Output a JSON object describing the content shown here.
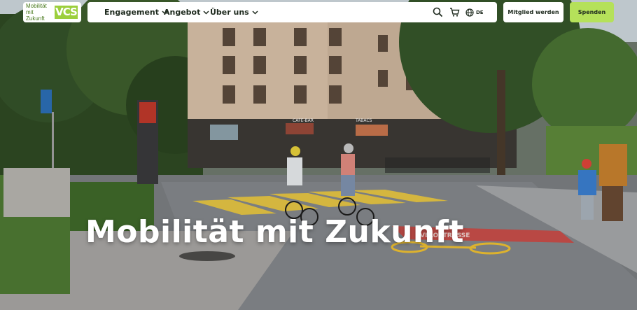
{
  "logo": {
    "text_line1": "Mobilität",
    "text_line2": "mit Zukunft",
    "mark": "VCS",
    "brand_green": "#9ccf3d"
  },
  "nav": {
    "items": [
      {
        "label": "Engagement",
        "icon": "chevron-down-icon"
      },
      {
        "label": "Angebot",
        "icon": "chevron-down-icon"
      },
      {
        "label": "Über uns",
        "icon": "chevron-down-icon"
      }
    ],
    "search_icon": "search-icon",
    "cart_icon": "cart-icon",
    "language": {
      "icon": "globe-icon",
      "label": "DE"
    }
  },
  "actions": {
    "member_label": "Mitglied werden",
    "donate_label": "Spenden",
    "donate_color": "#b5e15a"
  },
  "hero": {
    "title": "Mobilität mit Zukunft",
    "street_marking": "VELOSTRASSE",
    "shop_signs": [
      "CAFE-BAR",
      "TABACS"
    ]
  }
}
